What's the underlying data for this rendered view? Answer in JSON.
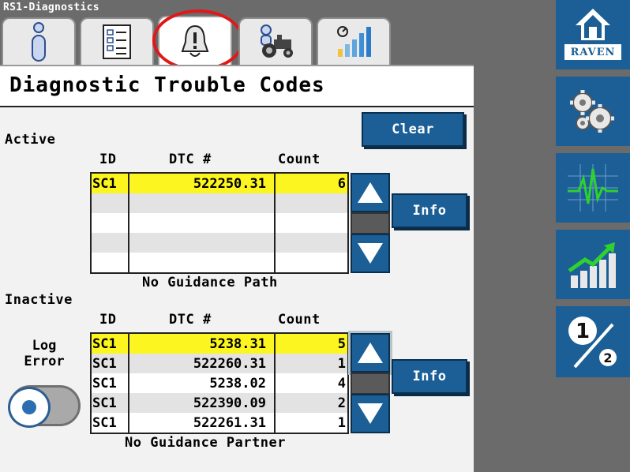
{
  "window": {
    "title": "RS1-Diagnostics"
  },
  "tabs": [
    {
      "icon": "info-icon",
      "active": false
    },
    {
      "icon": "checklist-icon",
      "active": false
    },
    {
      "icon": "alarm-bell-icon",
      "active": true
    },
    {
      "icon": "operator-tractor-icon",
      "active": false
    },
    {
      "icon": "signal-strength-icon",
      "active": false
    }
  ],
  "header": {
    "title": "Diagnostic Trouble Codes"
  },
  "buttons": {
    "clear_label": "Clear",
    "info_label": "Info"
  },
  "columns": {
    "id": "ID",
    "dtc": "DTC #",
    "count": "Count"
  },
  "active": {
    "label": "Active",
    "rows": [
      {
        "id": "SC1",
        "dtc": "522250.31",
        "count": "6",
        "selected": true
      },
      {
        "id": "",
        "dtc": "",
        "count": "",
        "selected": false
      },
      {
        "id": "",
        "dtc": "",
        "count": "",
        "selected": false
      },
      {
        "id": "",
        "dtc": "",
        "count": "",
        "selected": false
      },
      {
        "id": "",
        "dtc": "",
        "count": "",
        "selected": false
      }
    ],
    "description": "No Guidance Path"
  },
  "inactive": {
    "label": "Inactive",
    "rows": [
      {
        "id": "SC1",
        "dtc": "5238.31",
        "count": "5",
        "selected": true
      },
      {
        "id": "SC1",
        "dtc": "522260.31",
        "count": "1",
        "selected": false
      },
      {
        "id": "SC1",
        "dtc": "5238.02",
        "count": "4",
        "selected": false
      },
      {
        "id": "SC1",
        "dtc": "522390.09",
        "count": "2",
        "selected": false
      },
      {
        "id": "SC1",
        "dtc": "522261.31",
        "count": "1",
        "selected": false
      }
    ],
    "description": "No Guidance Partner"
  },
  "log_error": {
    "label_line1": "Log",
    "label_line2": "Error",
    "enabled": false
  },
  "rail": {
    "brand": "RAVEN",
    "items": [
      {
        "icon": "home-icon"
      },
      {
        "icon": "settings-gears-icon"
      },
      {
        "icon": "diagnostics-waveform-icon"
      },
      {
        "icon": "performance-chart-icon"
      },
      {
        "icon": "page-1-of-2-icon",
        "page_current": "1",
        "page_total": "2"
      }
    ]
  },
  "colors": {
    "accent_blue": "#1b5f96",
    "selected_row": "#fcf51f",
    "tab_highlight_ring": "#e01818",
    "rail_icon_green": "#2fd12f"
  }
}
